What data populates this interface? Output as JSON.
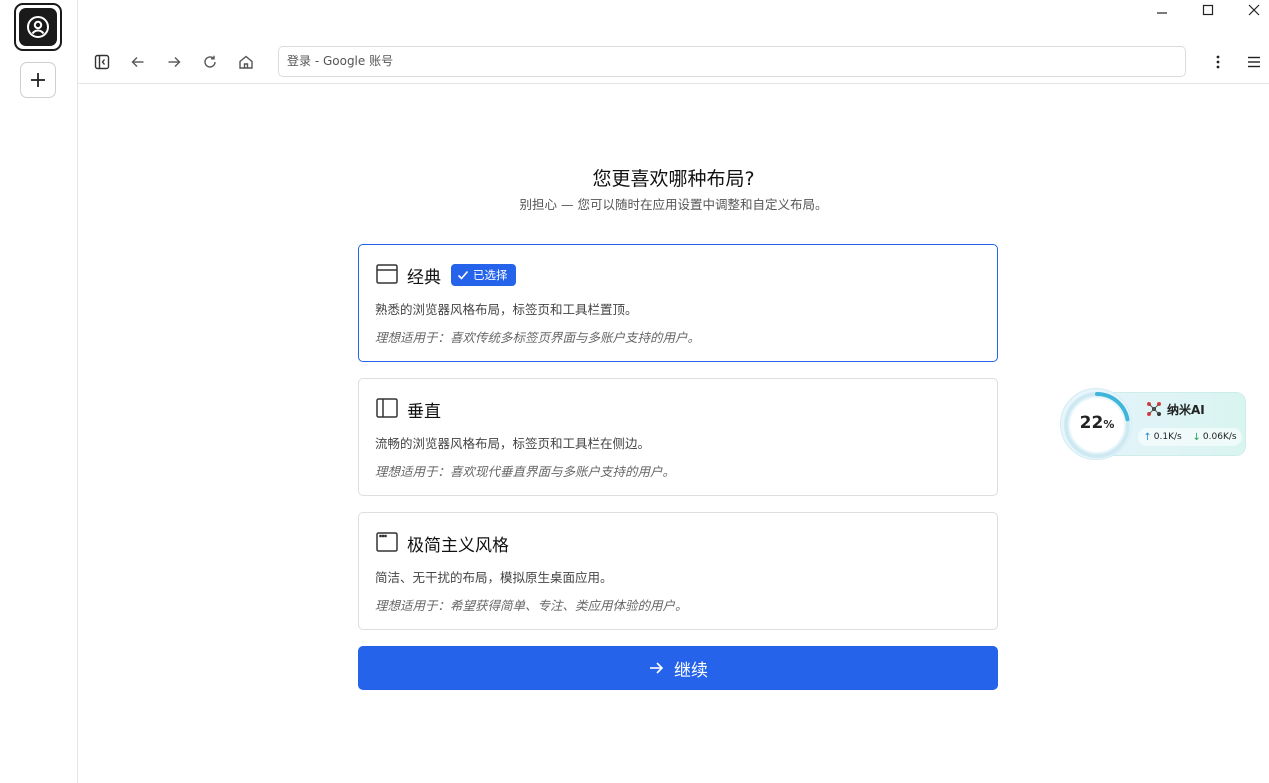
{
  "browser": {
    "address_bar_text": "登录 - Google 账号"
  },
  "page": {
    "heading": "您更喜欢哪种布局?",
    "subheading": "别担心 — 您可以随时在应用设置中调整和自定义布局。",
    "layouts": [
      {
        "title": "经典",
        "selected": true,
        "badge": "已选择",
        "description": "熟悉的浏览器风格布局，标签页和工具栏置顶。",
        "ideal_for": "理想适用于：喜欢传统多标签页界面与多账户支持的用户。",
        "icon": "classic-layout-icon"
      },
      {
        "title": "垂直",
        "selected": false,
        "description": "流畅的浏览器风格布局，标签页和工具栏在侧边。",
        "ideal_for": "理想适用于：喜欢现代垂直界面与多账户支持的用户。",
        "icon": "vertical-layout-icon"
      },
      {
        "title": "极简主义风格",
        "selected": false,
        "description": "简洁、无干扰的布局，模拟原生桌面应用。",
        "ideal_for": "理想适用于：希望获得简单、专注、类应用体验的用户。",
        "icon": "minimal-layout-icon"
      }
    ],
    "continue_label": "继续"
  },
  "widget": {
    "percent": "22",
    "percent_unit": "%",
    "name": "纳米AI",
    "upload": "0.1K/s",
    "download": "0.06K/s"
  },
  "colors": {
    "accent": "#2563eb",
    "border": "#dedede"
  }
}
